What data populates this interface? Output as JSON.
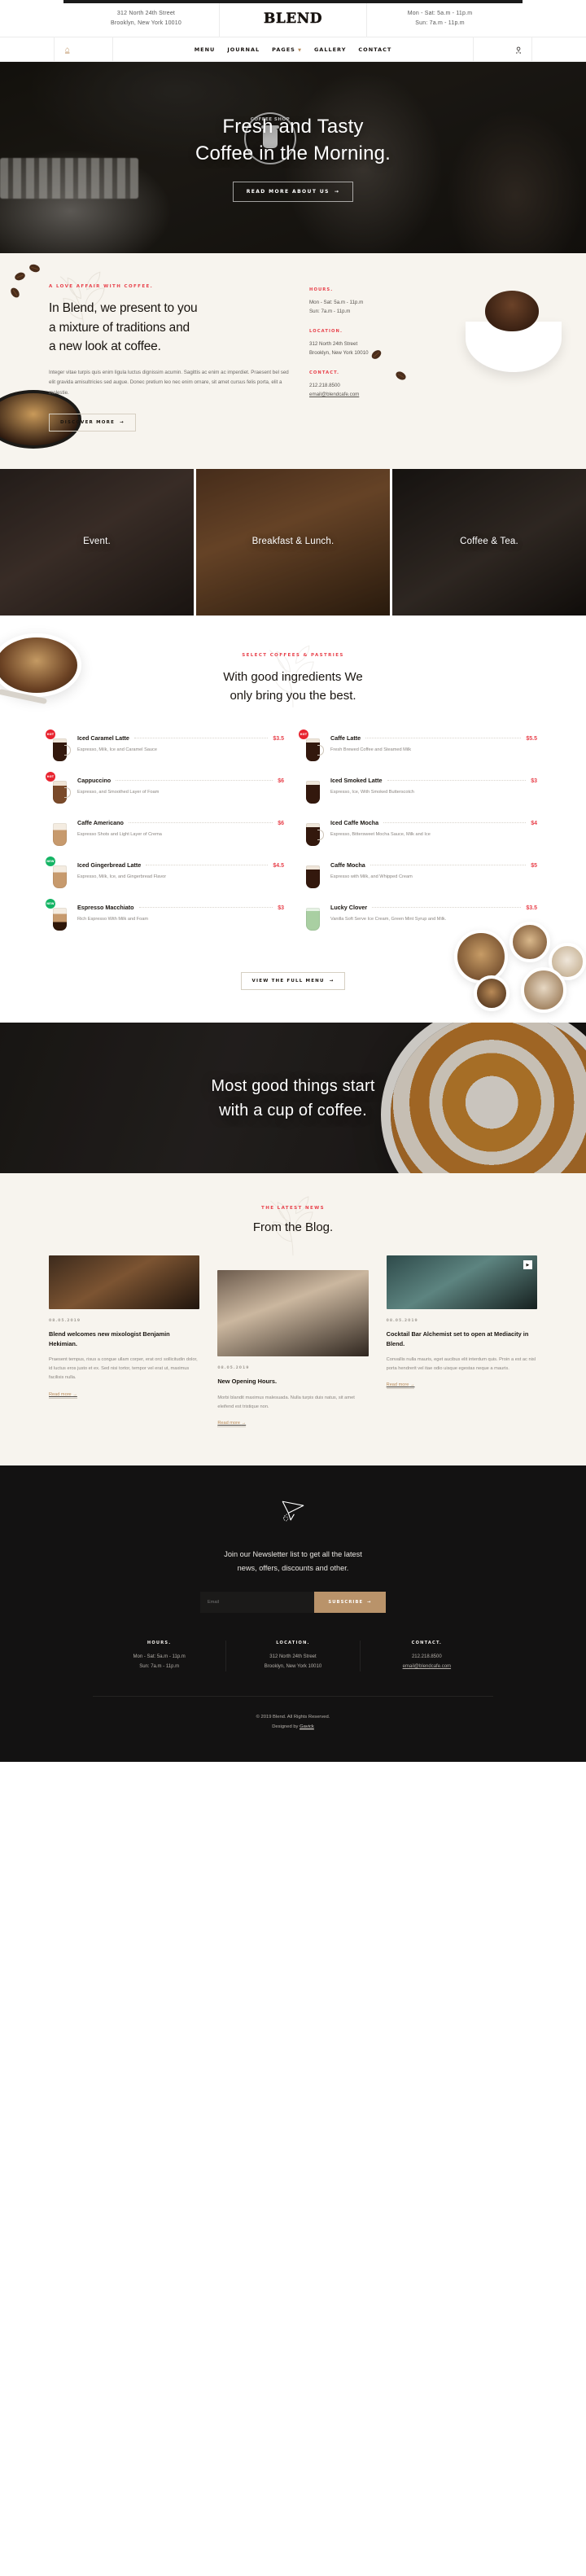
{
  "topbar": {
    "address_line1": "312 North 24th Street",
    "address_line2": "Brooklyn, New York 10010",
    "brand": "BLEND",
    "hours_line1": "Mon - Sat: 5a.m - 11p.m",
    "hours_line2": "Sun: 7a.m - 11p.m"
  },
  "nav": {
    "home_icon": "home-icon",
    "search_icon": "search-icon",
    "items": [
      {
        "label": "MENU",
        "has_caret": false
      },
      {
        "label": "JOURNAL",
        "has_caret": false
      },
      {
        "label": "PAGES",
        "has_caret": true
      },
      {
        "label": "GALLERY",
        "has_caret": false
      },
      {
        "label": "CONTACT",
        "has_caret": false
      }
    ]
  },
  "hero": {
    "badge_text": "COFFEE SHOP",
    "title_line1": "Fresh and Tasty",
    "title_line2": "Coffee in the Morning.",
    "cta": "READ MORE ABOUT US",
    "cta_arrow": "→"
  },
  "about": {
    "eyebrow": "A LOVE AFFAIR WITH COFFEE.",
    "heading_line1": "In Blend, we present to you",
    "heading_line2": "a mixture of traditions and",
    "heading_line3": "a new look at coffee.",
    "paragraph": "Integer vitae turpis quis enim ligula luctus dignissim acumin. Sagittis ac enim ac imperdiet. Praesent bel sed elit gravida amisultricies sed augue. Donec pretium leo nec enim ornare, sit amet cursus felis porta, elit a molestie.",
    "cta": "DISCOVER MORE",
    "cta_arrow": "→",
    "info": [
      {
        "label": "HOURS.",
        "line1": "Mon - Sat: 5a.m - 11p.m",
        "line2": "Sun: 7a.m - 11p.m"
      },
      {
        "label": "LOCATION.",
        "line1": "312 North 24th Street",
        "line2": "Brooklyn, New York 10010"
      },
      {
        "label": "CONTACT.",
        "line1": "212.218.8500",
        "line2": "email@blendcafe.com"
      }
    ]
  },
  "categories": [
    {
      "label": "Event."
    },
    {
      "label": "Breakfast & Lunch."
    },
    {
      "label": "Coffee & Tea."
    }
  ],
  "menu": {
    "eyebrow": "SELECT COFFEES & PASTRIES",
    "heading_line1": "With good ingredients We",
    "heading_line2": "only bring you the best.",
    "cta": "VIEW THE FULL MENU",
    "cta_arrow": "→",
    "left_items": [
      {
        "tag": "HOT",
        "name": "Iced Caramel Latte",
        "price": "$3.5",
        "desc": "Espresso, Milk, Ice and Caramel Sauce",
        "glass": "dark handle"
      },
      {
        "tag": "HOT",
        "name": "Cappuccino",
        "price": "$6",
        "desc": "Espresso, and Smoothed Layer of Foam",
        "glass": "handle"
      },
      {
        "tag": "",
        "name": "Caffe Americano",
        "price": "$6",
        "desc": "Espresso Shots and Light Layer of Crema",
        "glass": "light"
      },
      {
        "tag": "NEW",
        "name": "Iced Gingerbread Latte",
        "price": "$4.5",
        "desc": "Espresso, Milk, Ice, and Gingerbread Flavor",
        "glass": "light"
      },
      {
        "tag": "NEW",
        "name": "Espresso Macchiato",
        "price": "$3",
        "desc": "Rich Espresso With Milk and Foam",
        "glass": "layer"
      }
    ],
    "right_items": [
      {
        "tag": "HOT",
        "name": "Caffe Latte",
        "price": "$5.5",
        "desc": "Fresh Brewed Coffee and Steamed Milk",
        "glass": "dark handle"
      },
      {
        "tag": "",
        "name": "Iced Smoked Latte",
        "price": "$3",
        "desc": "Espresso, Ice, With Smoked Butterscotch",
        "glass": "dark"
      },
      {
        "tag": "",
        "name": "Iced Caffe Mocha",
        "price": "$4",
        "desc": "Espresso, Bittersweet Mocha Sauce, Milk and Ice",
        "glass": "dark handle"
      },
      {
        "tag": "",
        "name": "Caffe Mocha",
        "price": "$5",
        "desc": "Espresso with Milk, and Whipped Cream",
        "glass": "dark"
      },
      {
        "tag": "",
        "name": "Lucky Clover",
        "price": "$3.5",
        "desc": "Vanilla Soft Serve Ice Cream, Green Mint Syrup and Milk.",
        "glass": "green"
      }
    ]
  },
  "quote": {
    "line1": "Most good things start",
    "line2": "with a cup of coffee."
  },
  "blog": {
    "eyebrow": "THE LATEST NEWS",
    "heading": "From the Blog.",
    "posts": [
      {
        "date": "08.05.2019",
        "title": "Blend welcomes new mixologist Benjamin Hekimian.",
        "excerpt": "Praesent tempus, risus a congue ullam corper, erat orci sollicitudin dolor, id luctus eros justo et ex. Sed nisi tortor, tempor vel erat ut, maximus facilisis nulla.",
        "more": "Read more",
        "more_arrow": "→",
        "has_play": false
      },
      {
        "date": "08.05.2019",
        "title": "New Opening Hours.",
        "excerpt": "Morbi blandit maximus malesuada. Nulla turpis duis natus, sit amet eleifend est tristique non.",
        "more": "Read more",
        "more_arrow": "→",
        "has_play": false
      },
      {
        "date": "08.05.2019",
        "title": "Cocktail Bar Alchemist set to open at Mediacity in Blend.",
        "excerpt": "Convallis nulla mauris, eget aucibus elit interdum quis. Proin a est ac nisl porta hendrerit vel itae odio uisque egestas neque a mauris.",
        "more": "Read more",
        "more_arrow": "→",
        "has_play": true
      }
    ]
  },
  "footer": {
    "plane_icon": "paper-plane-icon",
    "news_line1": "Join our Newsletter list to get all the latest",
    "news_line2": "news, offers, discounts and other.",
    "email_placeholder": "Email",
    "subscribe_label": "SUBSCRIBE",
    "subscribe_arrow": "→",
    "columns": [
      {
        "label": "HOURS.",
        "line1": "Mon - Sat: 5a.m - 11p.m",
        "line2": "Sun: 7a.m - 11p.m"
      },
      {
        "label": "LOCATION.",
        "line1": "312 North 24th Street",
        "line2": "Brooklyn, New York 10010"
      },
      {
        "label": "CONTACT.",
        "line1": "212.218.8500",
        "line2": "email@blendcafe.com"
      }
    ],
    "copyright": "© 2019 Blend. All Rights Reserved.",
    "designed_prefix": "Designed by ",
    "designed_by": "Gavick"
  },
  "colors": {
    "accent_red": "#e8414b",
    "accent_tan": "#b9936a",
    "dark": "#131212",
    "cream": "#f7f4ee"
  }
}
